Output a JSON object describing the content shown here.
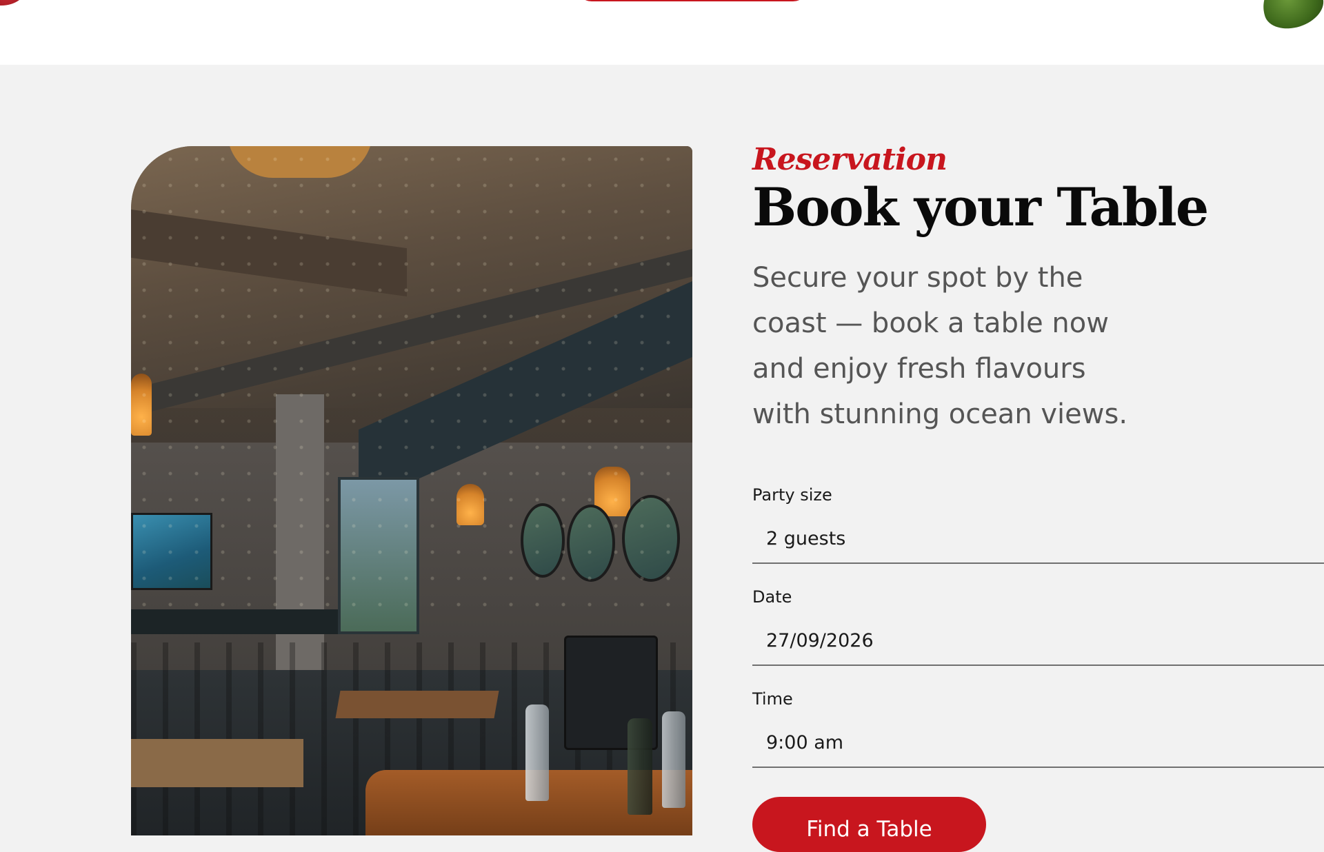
{
  "header": {
    "cta_label": ""
  },
  "reservation": {
    "eyebrow": "Reservation",
    "title": "Book your Table",
    "description": "Secure your spot by the coast — book a table now and enjoy fresh flavours with stunning ocean views.",
    "fields": {
      "party_size": {
        "label": "Party size",
        "value": "2 guests"
      },
      "date": {
        "label": "Date",
        "value": "27/09/2026"
      },
      "time": {
        "label": "Time",
        "value": "9:00 am"
      }
    },
    "submit_label": "Find a Table"
  },
  "photo": {
    "alt": "Restaurant interior"
  },
  "colors": {
    "accent": "#c8161e",
    "background": "#f2f2f2",
    "header_bg": "#ffffff",
    "title": "#0a0a0a",
    "body_text": "#555555"
  }
}
